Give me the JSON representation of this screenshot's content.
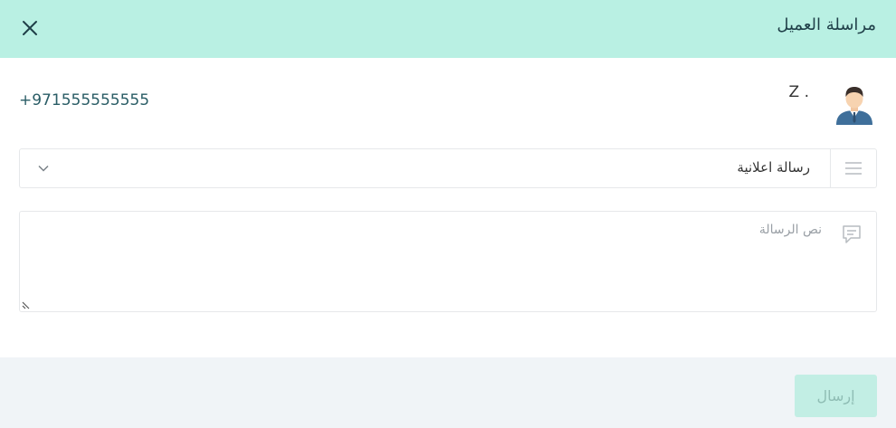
{
  "header": {
    "title": "مراسلة العميل",
    "close_icon": "close-icon"
  },
  "customer": {
    "name": "Z .",
    "phone": "+971555555555",
    "avatar_icon": "avatar-icon"
  },
  "message_type": {
    "icon": "list-icon",
    "selected_value": "رسالة اعلانية",
    "dropdown_icon": "chevron-down-icon"
  },
  "message_body": {
    "icon": "message-icon",
    "placeholder": "نص الرسالة",
    "value": ""
  },
  "footer": {
    "send_label": "إرسال"
  },
  "colors": {
    "header_bg": "#b9f0e3",
    "send_button_bg": "#c2eee4",
    "send_button_text": "#8fbdb4",
    "footer_bg": "#f0f4f7"
  }
}
